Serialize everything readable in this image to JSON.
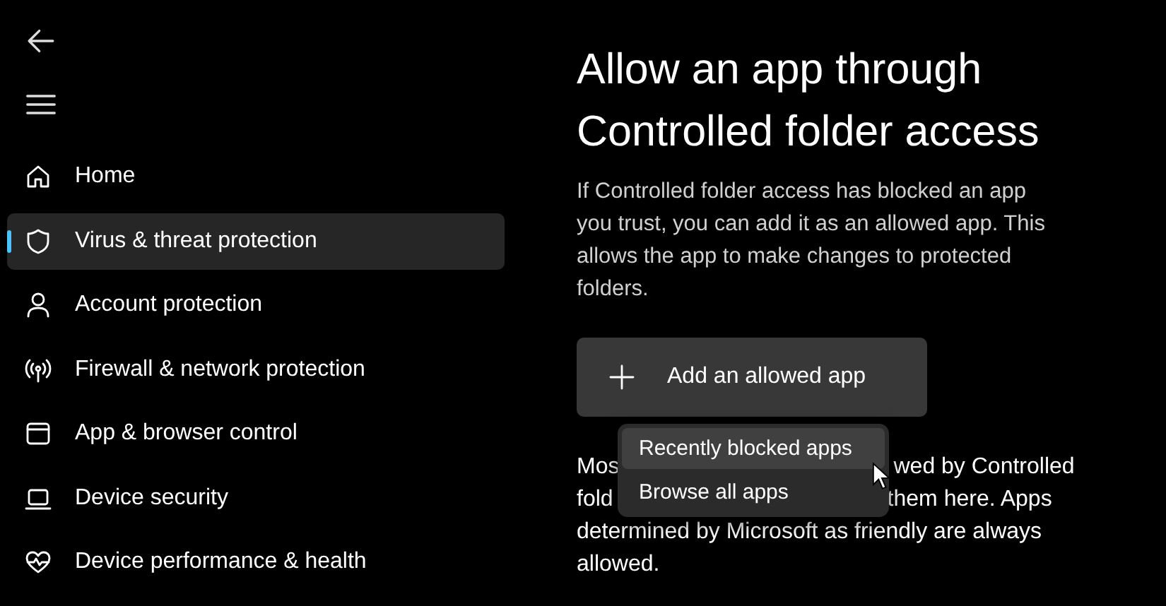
{
  "sidebar": {
    "items": [
      {
        "label": "Home",
        "selected": false
      },
      {
        "label": "Virus & threat protection",
        "selected": true
      },
      {
        "label": "Account protection",
        "selected": false
      },
      {
        "label": "Firewall & network protection",
        "selected": false
      },
      {
        "label": "App & browser control",
        "selected": false
      },
      {
        "label": "Device security",
        "selected": false
      },
      {
        "label": "Device performance & health",
        "selected": false
      }
    ]
  },
  "page": {
    "title": "Allow an app through Controlled folder access",
    "description": "If Controlled folder access has blocked an app you trust, you can add it as an allowed app. This allows the app to make changes to protected folders.",
    "add_button": "Add an allowed app",
    "menu": [
      {
        "label": "Recently blocked apps",
        "selected": true
      },
      {
        "label": "Browse all apps",
        "selected": false
      }
    ],
    "note_lines": [
      [
        "Mos",
        "wed by Controlled"
      ],
      [
        "fold",
        "them here. Apps"
      ],
      [
        "determined by Microsoft as friendly are always"
      ],
      [
        "allowed."
      ]
    ]
  }
}
